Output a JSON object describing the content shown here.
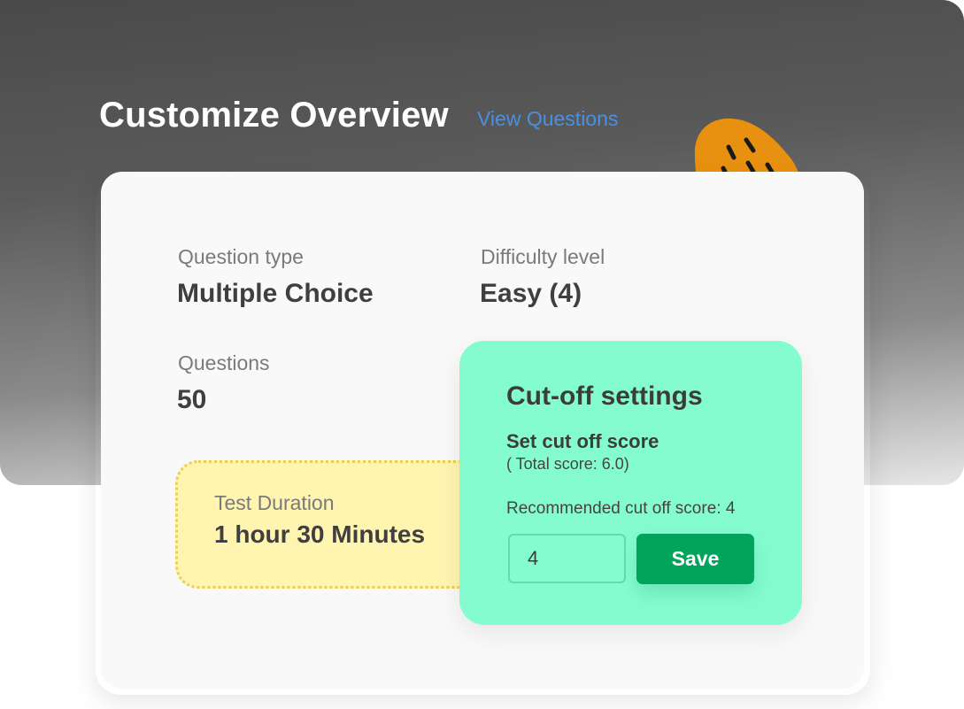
{
  "header": {
    "title": "Customize Overview",
    "view_link": "View Questions"
  },
  "overview": {
    "question_type": {
      "label": "Question type",
      "value": "Multiple Choice"
    },
    "difficulty": {
      "label": "Difficulty level",
      "value": "Easy (4)"
    },
    "questions": {
      "label": "Questions",
      "value": "50"
    },
    "duration": {
      "label": "Test Duration",
      "value": "1 hour 30 Minutes"
    }
  },
  "cutoff": {
    "title": "Cut-off settings",
    "subtitle": "Set cut off score",
    "total": "( Total score: 6.0)",
    "recommended": "Recommended cut off score: 4",
    "input_value": "4",
    "save_label": "Save"
  },
  "colors": {
    "link": "#4a90e2",
    "cutoff_bg": "#84fcd0",
    "save_button": "#00a45a",
    "duration_bg": "#fff4b0",
    "blob": "#e8900f"
  },
  "icons": {
    "decoration": "orange-blob-decoration"
  }
}
